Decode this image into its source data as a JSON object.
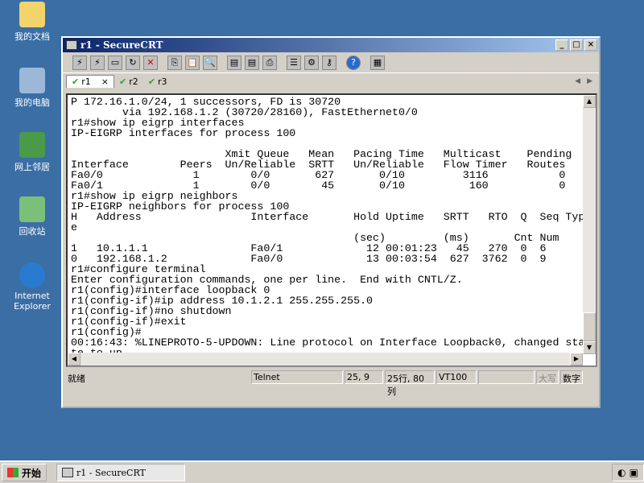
{
  "desktop": [
    "我的文档",
    "我的电脑",
    "网上邻居",
    "回收站",
    "Internet Explorer"
  ],
  "window": {
    "title": "r1 - SecureCRT",
    "min": "_",
    "max": "□",
    "close": "×"
  },
  "tabs": [
    {
      "label": "r1",
      "close": "×"
    },
    {
      "label": "r2"
    },
    {
      "label": "r3"
    }
  ],
  "terminal": {
    "lines": [
      "P 172.16.1.0/24, 1 successors, FD is 30720",
      "        via 192.168.1.2 (30720/28160), FastEthernet0/0",
      "r1#show ip eigrp interfaces",
      "IP-EIGRP interfaces for process 100",
      "",
      "                        Xmit Queue   Mean   Pacing Time   Multicast    Pending",
      "Interface        Peers  Un/Reliable  SRTT   Un/Reliable   Flow Timer   Routes",
      "Fa0/0              1        0/0       627       0/10         3116           0",
      "Fa0/1              1        0/0        45       0/10          160           0",
      "r1#show ip eigrp neighbors",
      "IP-EIGRP neighbors for process 100",
      "H   Address                 Interface       Hold Uptime   SRTT   RTO  Q  Seq Typ",
      "e",
      "                                            (sec)         (ms)       Cnt Num",
      "1   10.1.1.1                Fa0/1             12 00:01:23   45   270  0  6",
      "0   192.168.1.2             Fa0/0             13 00:03:54  627  3762  0  9",
      "r1#configure terminal",
      "Enter configuration commands, one per line.  End with CNTL/Z.",
      "r1(config)#interface loopback 0",
      "r1(config-if)#ip address 10.1.2.1 255.255.255.0",
      "r1(config-if)#no shutdown",
      "r1(config-if)#exit",
      "r1(config)#",
      "00:16:43: %LINEPROTO-5-UPDOWN: Line protocol on Interface Loopback0, changed sta",
      "te to up"
    ]
  },
  "status": {
    "ready": "就绪",
    "protocol": "Telnet",
    "cursor": "25, 9",
    "size": "25行, 80列",
    "emulation": "VT100",
    "caps": "大写",
    "num": "数字"
  },
  "taskbar": {
    "start": "开始",
    "task": "r1 - SecureCRT"
  }
}
